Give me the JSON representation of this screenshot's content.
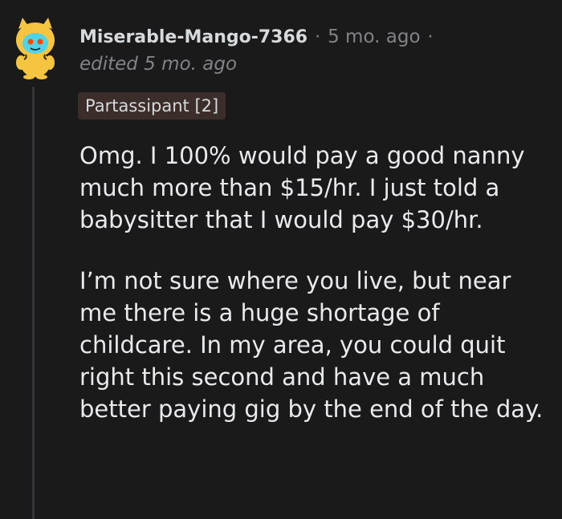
{
  "comment": {
    "author": "Miserable-Mango-7366",
    "separator": "·",
    "time": "5 mo. ago",
    "edited": "edited 5 mo. ago",
    "flair": "Partassipant [2]",
    "paragraphs": [
      "Omg. I 100% would pay a good nanny much more than $15/hr. I just told a babysitter that I would pay $30/hr.",
      "I’m not sure where you live, but near me there is a huge shortage of childcare. In my area, you could quit right this second and have a much better paying gig by the end of the day."
    ]
  },
  "colors": {
    "background": "#1a1a1b",
    "text": "#d7dadc",
    "muted": "#818384",
    "flair_bg": "#3a2d2a",
    "avatar_yellow": "#f5c542",
    "avatar_face": "#51d3e6"
  },
  "icons": {
    "avatar": "snoo-avatar-icon"
  }
}
